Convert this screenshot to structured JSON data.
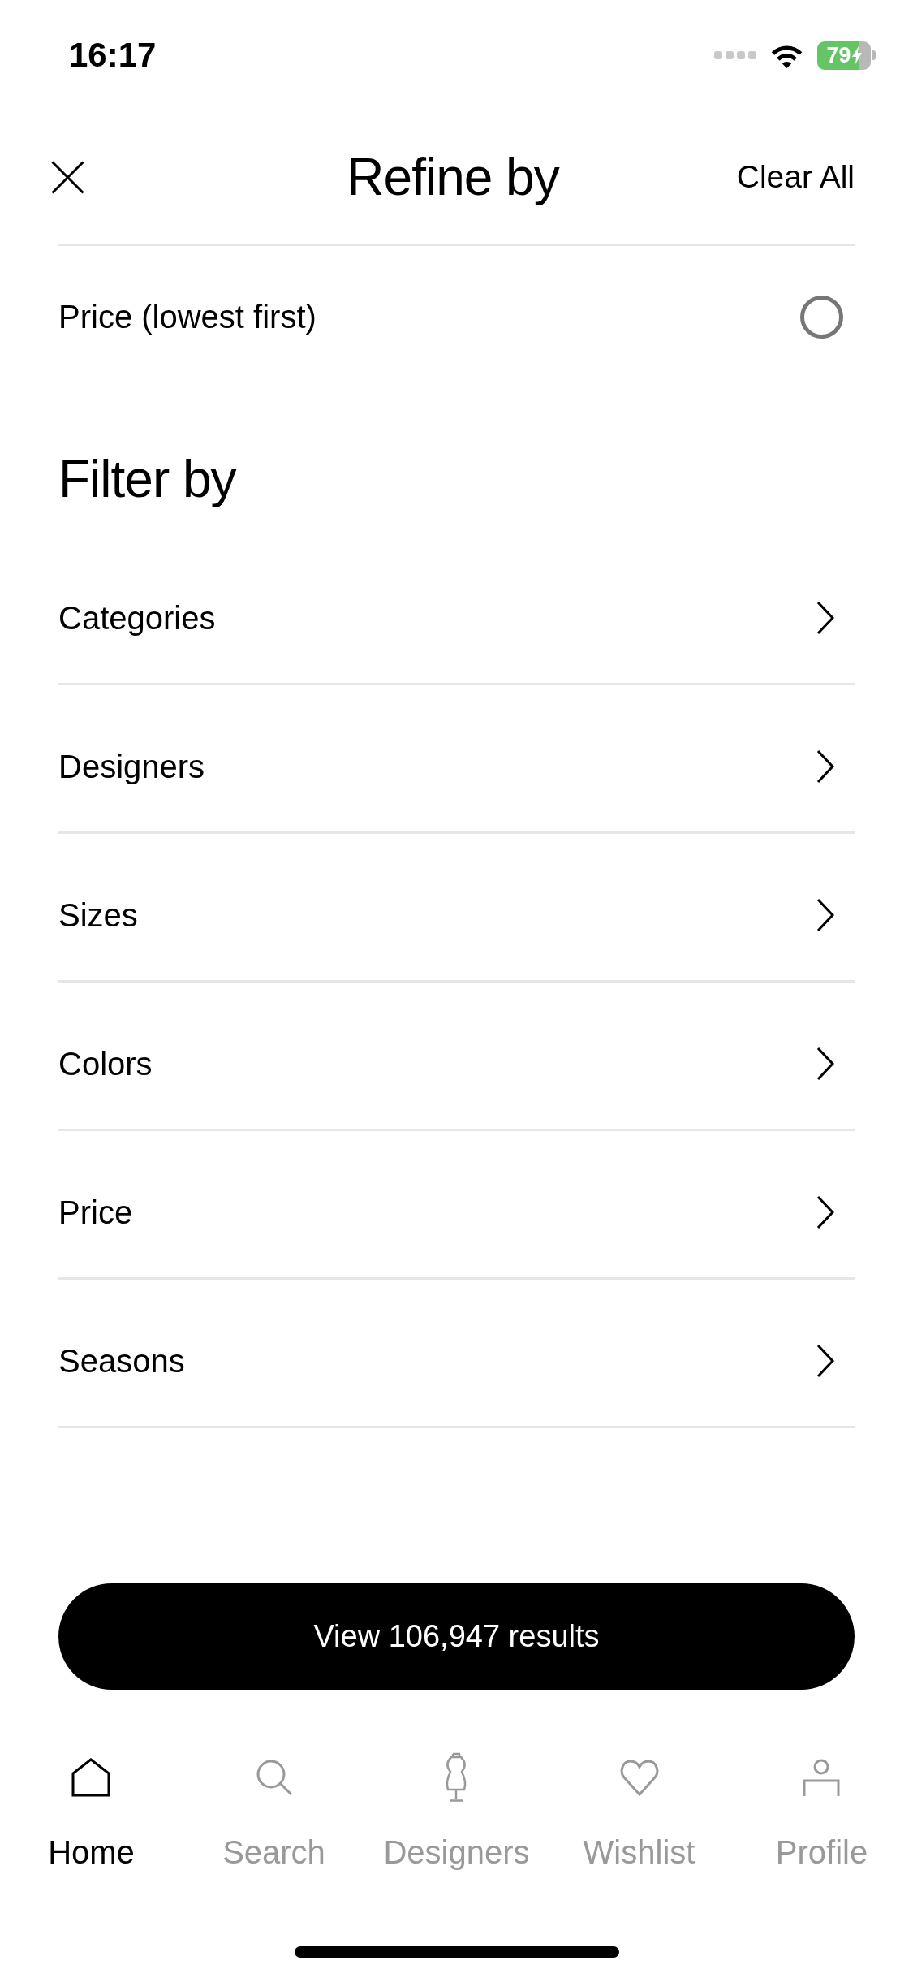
{
  "status_bar": {
    "time": "16:17",
    "battery": {
      "percent": "79",
      "charging": true
    }
  },
  "header": {
    "title": "Refine by",
    "action": "Clear All"
  },
  "sort_options": [
    {
      "label": "Price (lowest first)",
      "selected": false
    }
  ],
  "filter_section": {
    "title": "Filter by",
    "items": [
      {
        "label": "Categories"
      },
      {
        "label": "Designers"
      },
      {
        "label": "Sizes"
      },
      {
        "label": "Colors"
      },
      {
        "label": "Price"
      },
      {
        "label": "Seasons"
      }
    ]
  },
  "results_button": {
    "label": "View 106,947 results"
  },
  "tab_bar": {
    "items": [
      {
        "label": "Home",
        "selected": true
      },
      {
        "label": "Search",
        "selected": false
      },
      {
        "label": "Designers",
        "selected": false
      },
      {
        "label": "Wishlist",
        "selected": false
      },
      {
        "label": "Profile",
        "selected": false
      }
    ]
  }
}
